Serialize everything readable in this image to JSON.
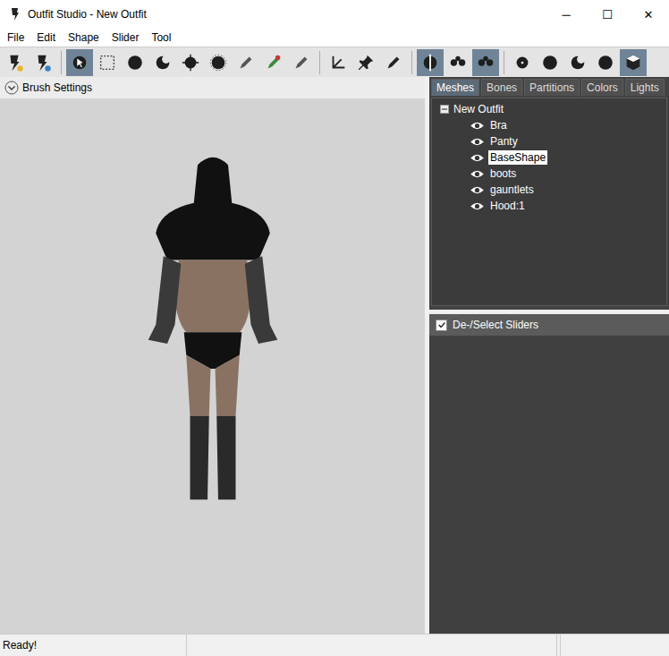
{
  "window": {
    "title": "Outfit Studio - New Outfit",
    "controls": [
      "─",
      "☐",
      "✕"
    ]
  },
  "menu": [
    "File",
    "Edit",
    "Shape",
    "Slider",
    "Tool"
  ],
  "toolbar": [
    {
      "kind": "outfit",
      "selected": false
    },
    {
      "kind": "shape",
      "selected": false
    },
    {
      "kind": "separator",
      "selected": false
    },
    {
      "kind": "brush",
      "selected": true
    },
    {
      "kind": "select",
      "selected": false
    },
    {
      "kind": "circle",
      "selected": false
    },
    {
      "kind": "crescent",
      "selected": false
    },
    {
      "kind": "move",
      "selected": false
    },
    {
      "kind": "ring",
      "selected": false
    },
    {
      "kind": "pen",
      "selected": false
    },
    {
      "kind": "color",
      "selected": false
    },
    {
      "kind": "pen",
      "selected": false
    },
    {
      "kind": "separator",
      "selected": false
    },
    {
      "kind": "axis",
      "selected": false
    },
    {
      "kind": "pin",
      "selected": false
    },
    {
      "kind": "pencil",
      "selected": false
    },
    {
      "kind": "separator",
      "selected": false
    },
    {
      "kind": "mirror",
      "selected": true
    },
    {
      "kind": "dots",
      "selected": false
    },
    {
      "kind": "dots",
      "selected": true
    },
    {
      "kind": "separator",
      "selected": false
    },
    {
      "kind": "dot",
      "selected": false
    },
    {
      "kind": "circle",
      "selected": false
    },
    {
      "kind": "crescent",
      "selected": false
    },
    {
      "kind": "circle",
      "selected": false
    },
    {
      "kind": "cube",
      "selected": true
    }
  ],
  "brush_settings": {
    "label": "Brush Settings",
    "expanded": false
  },
  "tabs": [
    {
      "label": "Meshes",
      "selected": true
    },
    {
      "label": "Bones",
      "selected": false
    },
    {
      "label": "Partitions",
      "selected": false
    },
    {
      "label": "Colors",
      "selected": false
    },
    {
      "label": "Lights",
      "selected": false
    }
  ],
  "tree": {
    "root": "New Outfit",
    "expanded": true,
    "items": [
      {
        "name": "Bra",
        "visible": true,
        "selected": false
      },
      {
        "name": "Panty",
        "visible": true,
        "selected": false
      },
      {
        "name": "BaseShape",
        "visible": true,
        "selected": true
      },
      {
        "name": "boots",
        "visible": true,
        "selected": false
      },
      {
        "name": "gauntlets",
        "visible": true,
        "selected": false
      },
      {
        "name": "Hood:1",
        "visible": true,
        "selected": false
      }
    ]
  },
  "sliders": {
    "label": "De-/Select Sliders",
    "checked": true
  },
  "status_bar": {
    "text": "Ready!"
  }
}
